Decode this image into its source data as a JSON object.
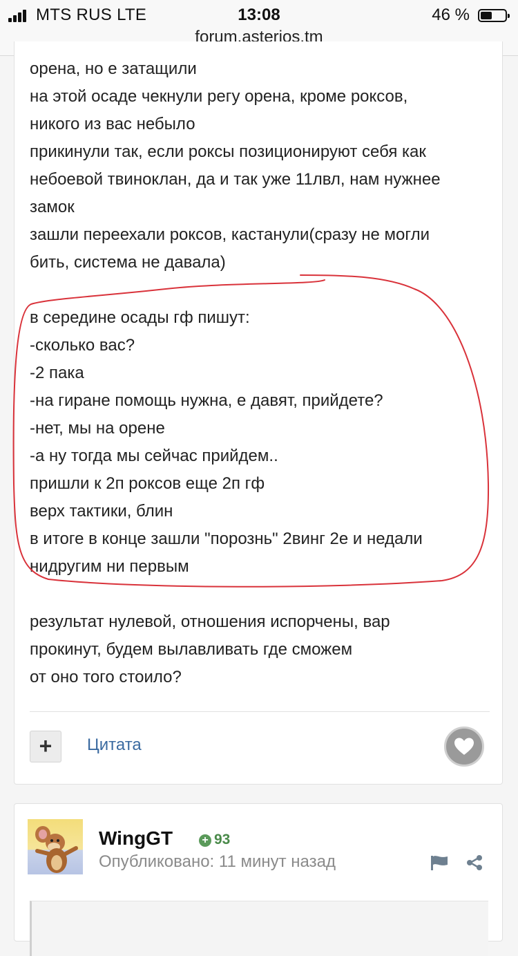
{
  "status_bar": {
    "carrier": "MTS RUS   LTE",
    "time": "13:08",
    "battery": "46 %",
    "battery_level": 0.46
  },
  "url_bar": {
    "url": "forum.asterios.tm"
  },
  "post": {
    "lines_before": [
      "орена, но е затащили",
      "на этой осаде чекнули регу орена, кроме роксов,",
      "никого из вас небыло",
      "прикинули так, если роксы позиционируют себя как",
      "небоевой твиноклан, да и так уже 11лвл, нам нужнее",
      "замок",
      "зашли переехали роксов, кастанули(сразу не могли",
      "бить, система не давала)"
    ],
    "lines_highlighted": [
      "в середине осады гф пишут:",
      "-сколько вас?",
      "-2 пака",
      "-на гиране помощь нужна, е давят, прийдете?",
      "-нет, мы на орене",
      "-а ну тогда мы сейчас прийдем..",
      "пришли к 2п роксов еще 2п гф",
      "верх тактики, блин",
      "в итоге в конце зашли \"порознь\" 2винг 2е и недали",
      "нидругим ни первым"
    ],
    "lines_after": [
      "результат нулевой, отношения испорчены, вар",
      "прокинут, будем вылавливать где сможем",
      "от оно того стоило?"
    ],
    "plus_label": "+",
    "quote_label": "Цитата",
    "annotation_color": "#d9323a"
  },
  "next_post": {
    "author": "WingGT",
    "reputation": "93",
    "published": "Опубликовано: 11 минут назад"
  },
  "colors": {
    "link": "#3a6aa0",
    "reputation": "#4a8a4a",
    "background": "#f5f5f5"
  }
}
